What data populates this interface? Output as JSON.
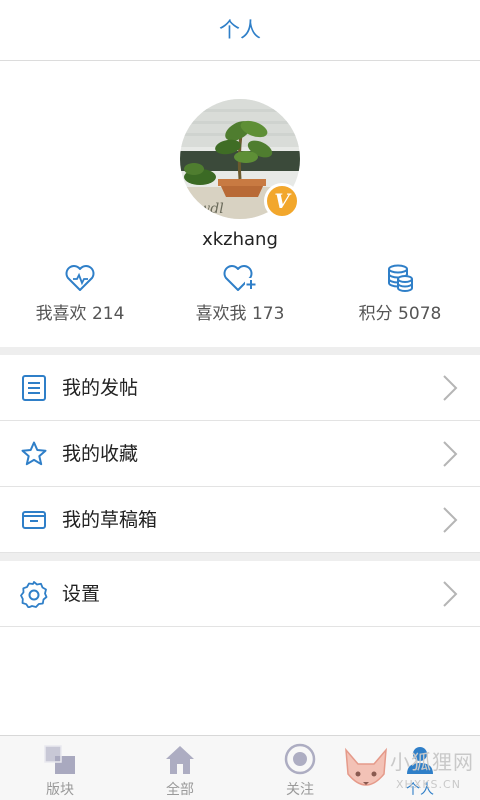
{
  "header": {
    "title": "个人"
  },
  "profile": {
    "avatar_icon": "user-avatar-plant-photo",
    "badge_text": "V",
    "username": "xkzhang",
    "stats": [
      {
        "label": "我喜欢 214",
        "icon": "heart-icon"
      },
      {
        "label": "喜欢我 173",
        "icon": "heart-plus-icon"
      },
      {
        "label": "积分 5078",
        "icon": "coins-icon"
      }
    ]
  },
  "menu": [
    {
      "label": "我的发帖",
      "icon": "list-doc-icon"
    },
    {
      "label": "我的收藏",
      "icon": "star-icon"
    },
    {
      "label": "我的草稿箱",
      "icon": "drafts-box-icon"
    }
  ],
  "settings": {
    "label": "设置",
    "icon": "gear-icon"
  },
  "tabbar": {
    "tabs": [
      {
        "label": "版块",
        "icon": "section-squares-icon",
        "active": false
      },
      {
        "label": "全部",
        "icon": "home-icon",
        "active": false
      },
      {
        "label": "关注",
        "icon": "follow-circle-icon",
        "active": false
      },
      {
        "label": "个人",
        "icon": "person-icon",
        "active": true
      }
    ]
  },
  "watermark": {
    "text": "小狐狸网",
    "sub": "XHXKS.CN"
  },
  "colors": {
    "accent": "#2f7fc8",
    "badge": "#f2a72c",
    "divider": "#eeeeee",
    "inactive": "#9a9a9a"
  }
}
